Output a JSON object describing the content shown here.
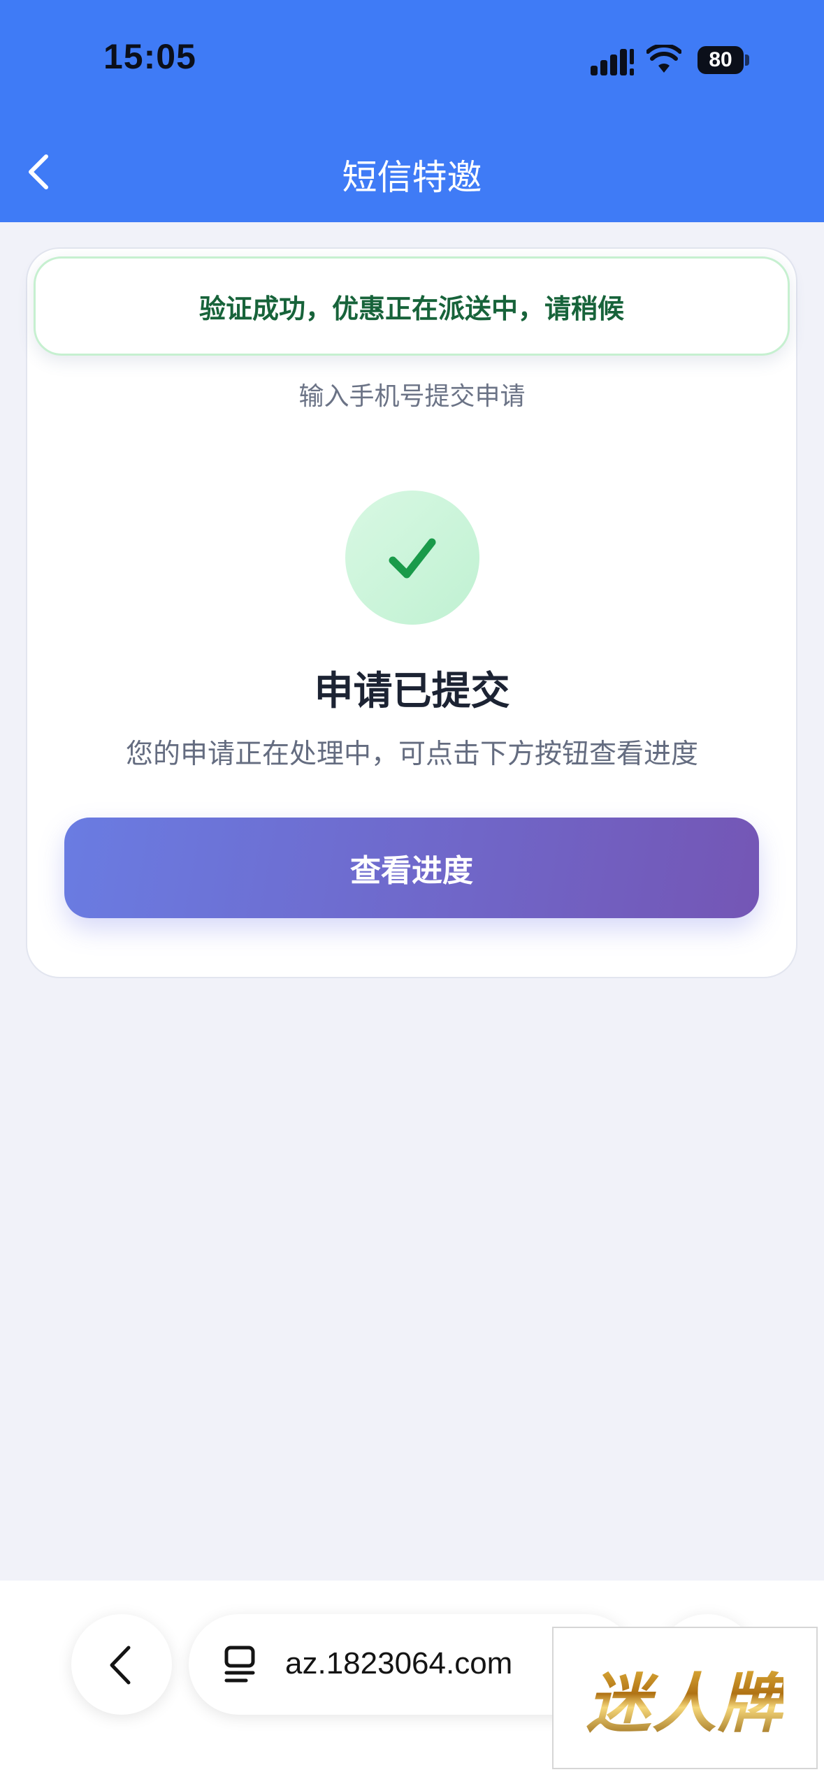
{
  "status_bar": {
    "time": "15:05",
    "battery": "80"
  },
  "nav": {
    "title": "短信特邀"
  },
  "toast": {
    "message": "验证成功，优惠正在派送中，请稍候"
  },
  "card": {
    "subtitle": "输入手机号提交申请",
    "success_title": "申请已提交",
    "success_desc": "您的申请正在处理中，可点击下方按钮查看进度",
    "button_label": "查看进度"
  },
  "browser": {
    "url": "az.1823064.com"
  },
  "watermark": {
    "text": "迷人牌"
  },
  "colors": {
    "header": "#3f7bf6",
    "toast_text": "#17633a",
    "check": "#1a9a4a",
    "button_start": "#6a7ce2",
    "button_end": "#7456b5"
  },
  "icons": [
    "back-chevron-icon",
    "check-icon",
    "signal-icon",
    "wifi-icon",
    "battery-icon",
    "tab-icon"
  ]
}
